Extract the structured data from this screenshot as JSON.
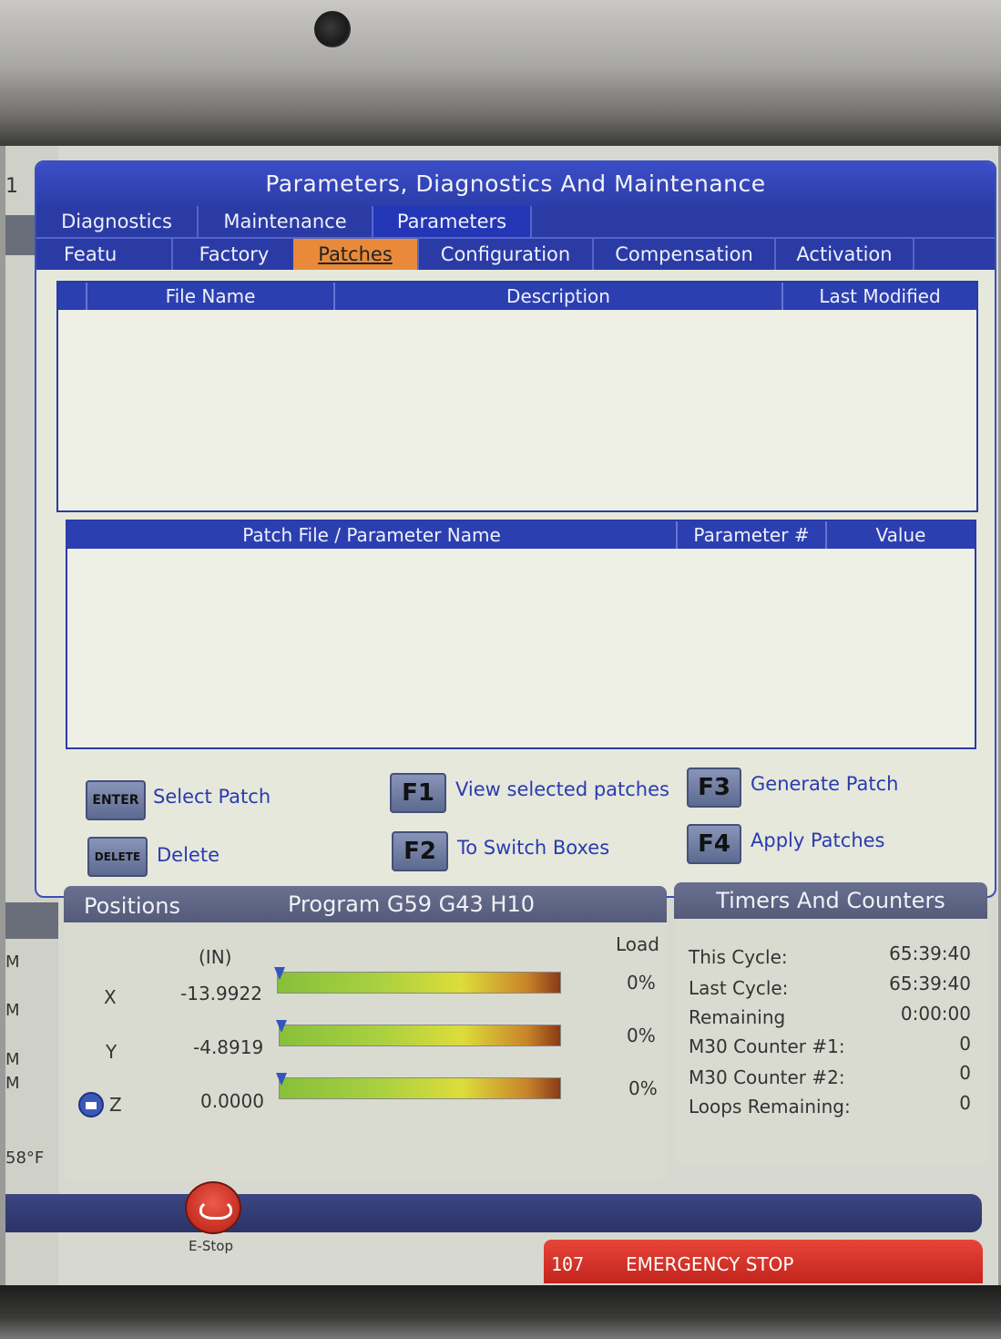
{
  "window": {
    "title": "Parameters, Diagnostics And Maintenance"
  },
  "tabs_top": [
    {
      "label": "Diagnostics"
    },
    {
      "label": "Maintenance"
    },
    {
      "label": "Parameters"
    }
  ],
  "tabs_sub": [
    {
      "label": "Featu"
    },
    {
      "label": "Factory"
    },
    {
      "label": "Patches"
    },
    {
      "label": "Configuration"
    },
    {
      "label": "Compensation"
    },
    {
      "label": "Activation"
    }
  ],
  "patch_table": {
    "columns": [
      "File Name",
      "Description",
      "Last Modified"
    ],
    "rows": []
  },
  "param_table": {
    "columns": [
      "Patch File / Parameter Name",
      "Parameter #",
      "Value"
    ],
    "rows": []
  },
  "keys": {
    "enter": {
      "key": "ENTER",
      "label": "Select Patch"
    },
    "delete": {
      "key": "DELETE",
      "label": "Delete"
    },
    "f1": {
      "key": "F1",
      "label": "View selected patches"
    },
    "f2": {
      "key": "F2",
      "label": "To Switch Boxes"
    },
    "f3": {
      "key": "F3",
      "label": "Generate Patch"
    },
    "f4": {
      "key": "F4",
      "label": "Apply Patches"
    }
  },
  "positions": {
    "title": "Positions",
    "program": "Program G59 G43 H10",
    "units": "(IN)",
    "load_label": "Load",
    "axes": [
      {
        "axis": "X",
        "value": "-13.9922",
        "load": "0%"
      },
      {
        "axis": "Y",
        "value": "-4.8919",
        "load": "0%"
      },
      {
        "axis": "Z",
        "value": "0.0000",
        "load": "0%"
      }
    ]
  },
  "timers": {
    "title": "Timers And Counters",
    "rows": [
      {
        "label": "This Cycle:",
        "value": "65:39:40"
      },
      {
        "label": "Last Cycle:",
        "value": "65:39:40"
      },
      {
        "label": "Remaining",
        "value": "0:00:00"
      },
      {
        "label": "M30 Counter #1:",
        "value": "0"
      },
      {
        "label": "M30 Counter #2:",
        "value": "0"
      },
      {
        "label": "Loops Remaining:",
        "value": "0"
      }
    ]
  },
  "left_strip": {
    "top_char": "1",
    "letters": [
      "M",
      "M",
      "M",
      "M"
    ],
    "temperature": "58°F"
  },
  "estop": {
    "label": "E-Stop"
  },
  "alarm": {
    "code": "107",
    "text": "EMERGENCY STOP"
  }
}
